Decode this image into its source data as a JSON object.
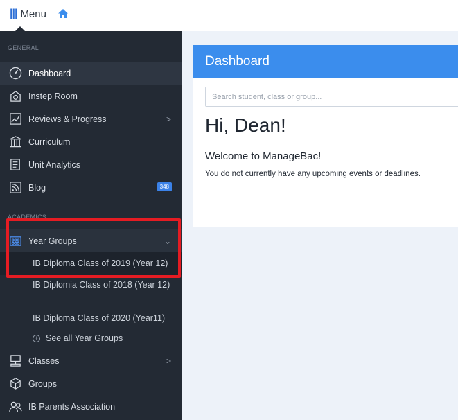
{
  "topbar": {
    "menu_icon": "|||",
    "menu_label": "Menu",
    "home_icon": "home-icon"
  },
  "sidebar": {
    "general_label": "GENERAL",
    "academics_label": "ACADEMICS",
    "items": [
      {
        "label": "Dashboard",
        "icon": "dashboard-gauge-icon",
        "active": true
      },
      {
        "label": "Instep Room",
        "icon": "instep-room-icon"
      },
      {
        "label": "Reviews & Progress",
        "icon": "progress-chart-icon",
        "chevron": ">"
      },
      {
        "label": "Curriculum",
        "icon": "curriculum-building-icon"
      },
      {
        "label": "Unit Analytics",
        "icon": "unit-analytics-icon"
      },
      {
        "label": "Blog",
        "icon": "blog-icon",
        "badge": "348"
      }
    ],
    "year_groups": {
      "label": "Year Groups",
      "icon": "year-groups-icon",
      "chevron": "⌄",
      "children": [
        "IB Diploma Class of 2019 (Year 12)",
        "IB Diplomia Class of 2018 (Year 12)",
        "IB Diploma Class of 2020 (Year11)"
      ],
      "see_all_label": "See all Year Groups"
    },
    "more_items": [
      {
        "label": "Classes",
        "icon": "classes-icon",
        "chevron": ">"
      },
      {
        "label": "Groups",
        "icon": "groups-icon"
      },
      {
        "label": "IB Parents Association",
        "icon": "parents-association-icon"
      }
    ]
  },
  "main": {
    "panel_title": "Dashboard",
    "search_placeholder": "Search student, class or group...",
    "greeting": "Hi, Dean!",
    "welcome": "Welcome to ManageBac!",
    "no_events": "You do not currently have any upcoming events or deadlines."
  },
  "colors": {
    "sidebar_bg": "#232a34",
    "accent_blue": "#3b8ded",
    "highlight_red": "#e51c23",
    "main_bg": "#edf2f9"
  }
}
